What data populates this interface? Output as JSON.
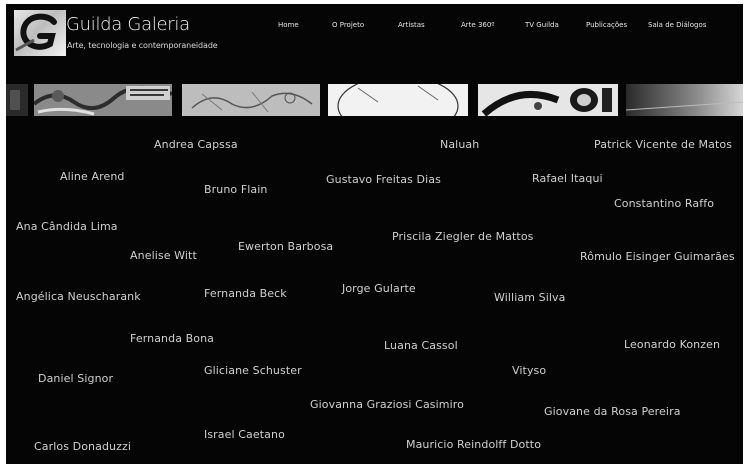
{
  "header": {
    "title": "Guilda Galeria",
    "tagline": "Arte, tecnologia e contemporaneidade"
  },
  "nav": {
    "items": [
      {
        "label": "Home"
      },
      {
        "label": "O Projeto"
      },
      {
        "label": "Artistas"
      },
      {
        "label": "Arte 360º"
      },
      {
        "label": "TV Guilda"
      },
      {
        "label": "Publicações"
      },
      {
        "label": "Sala de Diálogos"
      }
    ]
  },
  "artists": [
    {
      "name": "Andrea Capssa"
    },
    {
      "name": "Naluah"
    },
    {
      "name": "Patrick Vicente de Matos"
    },
    {
      "name": "Aline Arend"
    },
    {
      "name": "Bruno Flain"
    },
    {
      "name": "Gustavo Freitas Dias"
    },
    {
      "name": "Rafael Itaqui"
    },
    {
      "name": "Constantino Raffo"
    },
    {
      "name": "Ana Cândida Lima"
    },
    {
      "name": "Anelise Witt"
    },
    {
      "name": "Ewerton Barbosa"
    },
    {
      "name": "Priscila Ziegler de Mattos"
    },
    {
      "name": "Rômulo Eisinger Guimarães"
    },
    {
      "name": "Angélica Neuscharank"
    },
    {
      "name": "Fernanda Beck"
    },
    {
      "name": "Jorge Gularte"
    },
    {
      "name": "William Silva"
    },
    {
      "name": "Fernanda Bona"
    },
    {
      "name": "Luana Cassol"
    },
    {
      "name": "Leonardo Konzen"
    },
    {
      "name": "Daniel Signor"
    },
    {
      "name": "Gliciane Schuster"
    },
    {
      "name": "Vityso"
    },
    {
      "name": "Giovanna Graziosi Casimiro"
    },
    {
      "name": "Giovane da Rosa Pereira"
    },
    {
      "name": "Carlos Donaduzzi"
    },
    {
      "name": "Israel Caetano"
    },
    {
      "name": "Mauricio Reindolff Dotto"
    }
  ]
}
